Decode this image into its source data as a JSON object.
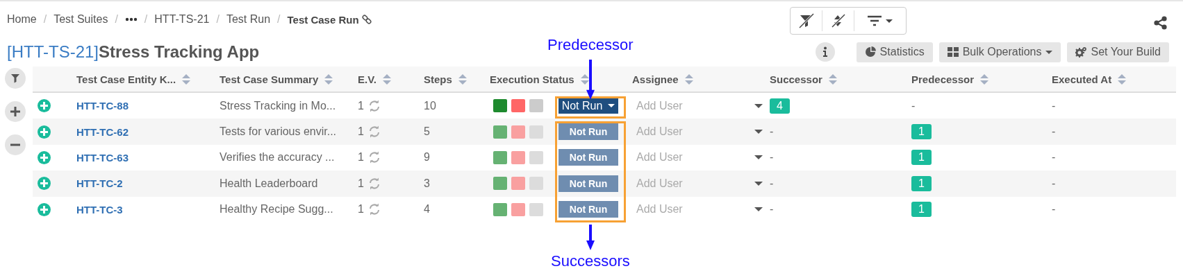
{
  "breadcrumb": [
    {
      "kind": "link",
      "text": "Home"
    },
    {
      "kind": "separator",
      "text": "/"
    },
    {
      "kind": "link",
      "text": "Test Suites"
    },
    {
      "kind": "separator",
      "text": "/"
    },
    {
      "kind": "more"
    },
    {
      "kind": "separator",
      "text": "/"
    },
    {
      "kind": "link",
      "text": "HTT-TS-21"
    },
    {
      "kind": "separator",
      "text": "/"
    },
    {
      "kind": "link",
      "text": "Test Run"
    },
    {
      "kind": "separator",
      "text": "/"
    },
    {
      "kind": "current",
      "text": "Test Case Run"
    }
  ],
  "title": {
    "key": "[HTT-TS-21]",
    "name": "Stress Tracking App"
  },
  "actions": [
    {
      "kind": "statistics",
      "label": "Statistics",
      "dropdown": false
    },
    {
      "kind": "bulk",
      "label": "Bulk Operations",
      "dropdown": true
    },
    {
      "kind": "build",
      "label": "Set Your Build",
      "dropdown": false
    }
  ],
  "table": {
    "columns": [
      "Test Case Entity K...",
      "Test Case Summary",
      "E.V.",
      "Steps",
      "Execution Status",
      "Assignee",
      "Successor",
      "Predecessor",
      "Executed At"
    ],
    "rows": [
      {
        "key": "HTT-TC-88",
        "summary": "Stress Tracking in Mo...",
        "ev": "1",
        "steps": "10",
        "selected": true,
        "status": "Not Run",
        "assignee": "Add User",
        "successor": {
          "kind": "badge",
          "text": "4"
        },
        "predecessor": {
          "kind": "plain",
          "text": "-"
        },
        "executed_at": "-"
      },
      {
        "key": "HTT-TC-62",
        "summary": "Tests for various envir...",
        "ev": "1",
        "steps": "5",
        "selected": false,
        "status": "Not Run",
        "assignee": "Add User",
        "successor": {
          "kind": "plain",
          "text": "-"
        },
        "predecessor": {
          "kind": "badge",
          "text": "1"
        },
        "executed_at": "-"
      },
      {
        "key": "HTT-TC-63",
        "summary": "Verifies the accuracy ...",
        "ev": "1",
        "steps": "9",
        "selected": false,
        "status": "Not Run",
        "assignee": "Add User",
        "successor": {
          "kind": "plain",
          "text": "-"
        },
        "predecessor": {
          "kind": "badge",
          "text": "1"
        },
        "executed_at": "-"
      },
      {
        "key": "HTT-TC-2",
        "summary": "Health Leaderboard",
        "ev": "1",
        "steps": "3",
        "selected": false,
        "status": "Not Run",
        "assignee": "Add User",
        "successor": {
          "kind": "plain",
          "text": "-"
        },
        "predecessor": {
          "kind": "badge",
          "text": "1"
        },
        "executed_at": "-"
      },
      {
        "key": "HTT-TC-3",
        "summary": "Healthy Recipe Sugg...",
        "ev": "1",
        "steps": "4",
        "selected": false,
        "status": "Not Run",
        "assignee": "Add User",
        "successor": {
          "kind": "plain",
          "text": "-"
        },
        "predecessor": {
          "kind": "badge",
          "text": "1"
        },
        "executed_at": "-"
      }
    ]
  },
  "annotations": [
    {
      "kind": "above",
      "text": "Predecessor"
    },
    {
      "kind": "below",
      "text": "Successors"
    }
  ]
}
